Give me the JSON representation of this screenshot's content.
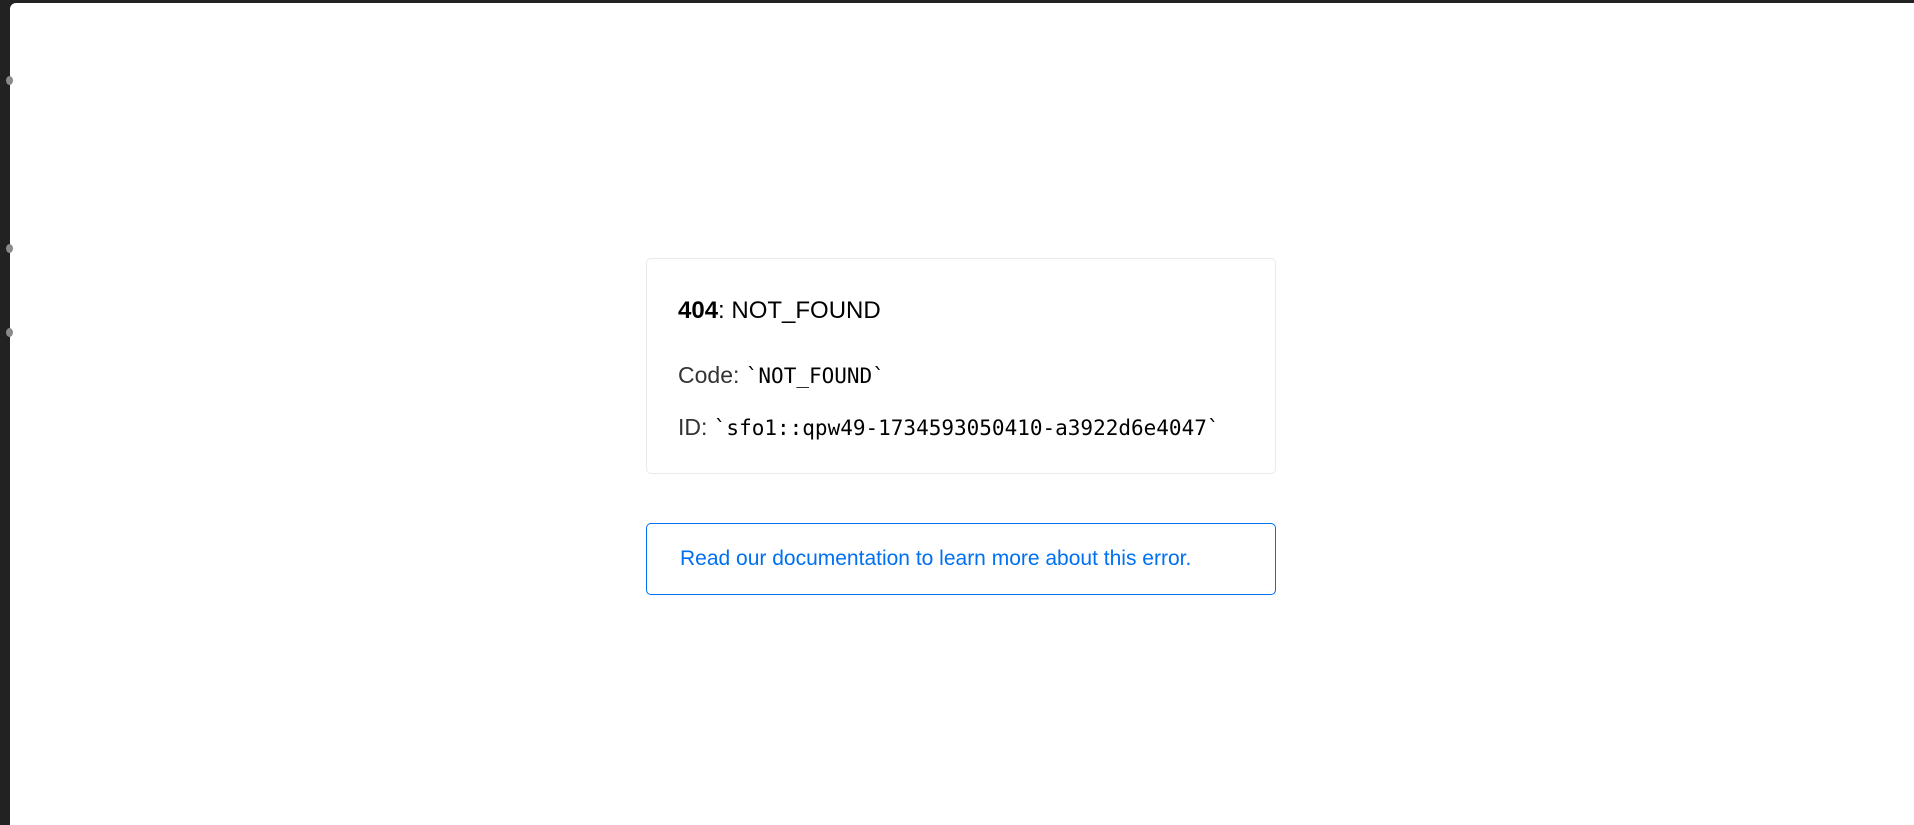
{
  "error": {
    "status_code": "404",
    "status_text": ": NOT_FOUND",
    "code_label": "Code: ",
    "code_value": "`NOT_FOUND`",
    "id_label": "ID: ",
    "id_value": "`sfo1::qpw49-1734593050410-a3922d6e4047`"
  },
  "docs": {
    "link_text": "Read our documentation to learn more about this error."
  },
  "colors": {
    "link": "#0070f3",
    "card_border": "#eaeaea",
    "background": "#ffffff"
  }
}
